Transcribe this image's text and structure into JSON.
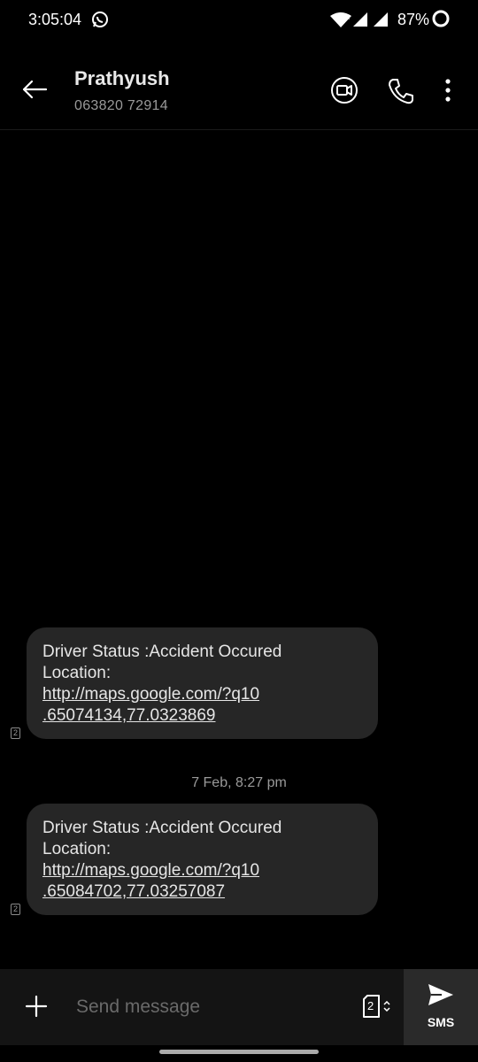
{
  "status_bar": {
    "time": "3:05:04",
    "battery": "87%"
  },
  "header": {
    "contact_name": "Prathyush",
    "contact_number": "063820 72914"
  },
  "messages": [
    {
      "line1": "Driver Status :Accident Occured",
      "line2": "Location:",
      "link_line1": "http://maps.google.com/?q10",
      "link_line2": ".65074134,77.0323869",
      "sim": "2"
    },
    {
      "line1": "Driver Status :Accident Occured",
      "line2": "Location:",
      "link_line1": "http://maps.google.com/?q10",
      "link_line2": ".65084702,77.03257087",
      "sim": "2"
    }
  ],
  "date_separator": "7 Feb, 8:27 pm",
  "composer": {
    "placeholder": "Send message",
    "sim_number": "2",
    "send_label": "SMS"
  },
  "colors": {
    "background": "#000000",
    "bubble": "#262626",
    "composer": "#141414",
    "secondary_text": "#9a9a9a"
  }
}
